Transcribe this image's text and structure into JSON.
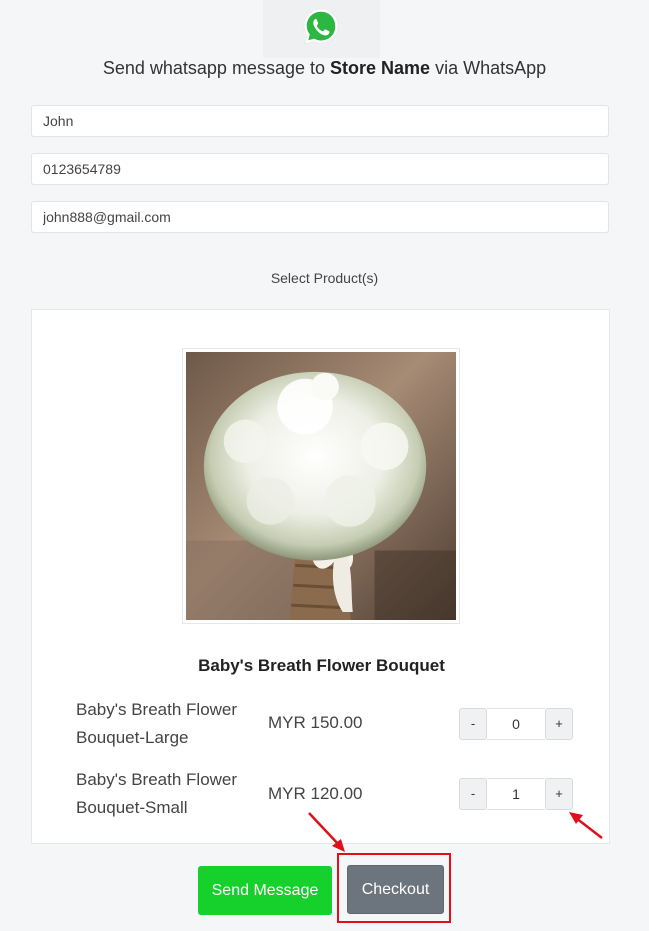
{
  "header": {
    "prefix": "Send whatsapp message to",
    "store_name": "Store Name",
    "suffix": "via WhatsApp",
    "icon": "whatsapp-icon"
  },
  "form": {
    "name_value": "John",
    "phone_value": "0123654789",
    "email_value": "john888@gmail.com"
  },
  "select_label": "Select Product(s)",
  "product": {
    "title": "Baby's Breath Flower Bouquet",
    "variants": [
      {
        "name_line1": "Baby's Breath Flower",
        "name_line2": "Bouquet-Large",
        "price": "MYR 150.00",
        "qty": "0"
      },
      {
        "name_line1": "Baby's Breath Flower",
        "name_line2": "Bouquet-Small",
        "price": "MYR 120.00",
        "qty": "1"
      }
    ],
    "minus_label": "-",
    "plus_label": "+"
  },
  "actions": {
    "send_label": "Send Message",
    "checkout_label": "Checkout"
  },
  "colors": {
    "send_bg": "#16d12c",
    "checkout_bg": "#6c757d",
    "annotation": "#e0101b"
  }
}
